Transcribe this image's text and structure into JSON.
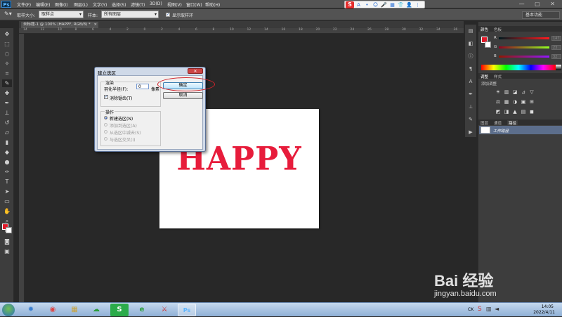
{
  "app": {
    "logo": "Ps",
    "menus": [
      "文件(F)",
      "编辑(E)",
      "图像(I)",
      "图层(L)",
      "文字(Y)",
      "选择(S)",
      "滤镜(T)",
      "3D(D)",
      "视图(V)",
      "窗口(W)",
      "帮助(H)"
    ],
    "window_controls": "—  ▢  ✕"
  },
  "ime": {
    "logo": "S",
    "icons": [
      "A",
      "•",
      "☺",
      "🎤",
      "▦",
      "👕",
      "👤",
      "⋮"
    ]
  },
  "options_bar": {
    "sample_size_label": "取样大小:",
    "sample_size_value": "取样点",
    "sample_label": "样本:",
    "sample_value": "所有图层",
    "show_ring_label": "显示取样环",
    "show_ring_checked": true,
    "workspace": "基本功能"
  },
  "document_tab": {
    "title": "未标题-1 @ 100% (HAPPY, RGB/8) *",
    "close": "×"
  },
  "ruler_h_ticks": [
    "14",
    "12",
    "10",
    "8",
    "6",
    "4",
    "2",
    "0",
    "2",
    "4",
    "6",
    "8",
    "10",
    "12",
    "14",
    "16",
    "18",
    "20",
    "22",
    "24",
    "26",
    "28",
    "30",
    "32",
    "34",
    "36"
  ],
  "canvas": {
    "text": "HAPPY",
    "text_color": "#e71c3b"
  },
  "dialog": {
    "title": "建立选区",
    "close": "✕",
    "render_group": "渲染",
    "feather_label": "羽化半径(F):",
    "feather_value": "0",
    "feather_unit": "像素",
    "anti_alias_label": "消除锯齿(T)",
    "anti_alias_checked": true,
    "operation_group": "操作",
    "operations": [
      {
        "label": "新建选区(N)",
        "selected": true,
        "enabled": true
      },
      {
        "label": "添加到选区(A)",
        "selected": false,
        "enabled": false
      },
      {
        "label": "从选区中减去(S)",
        "selected": false,
        "enabled": false
      },
      {
        "label": "与选区交叉(I)",
        "selected": false,
        "enabled": false
      }
    ],
    "ok_label": "确定",
    "cancel_label": "取消",
    "highlight_color": "#d2232a"
  },
  "color_panel": {
    "tabs": [
      "颜色",
      "色板"
    ],
    "fg_color": "#e11a2a",
    "sliders": [
      {
        "name": "R",
        "value": "147"
      },
      {
        "name": "G",
        "value": "23"
      },
      {
        "name": "B",
        "value": "32"
      }
    ]
  },
  "adjustments_panel": {
    "tabs": [
      "调整",
      "样式"
    ],
    "add_label": "添加调整",
    "row1": [
      "☀",
      "▥",
      "◪",
      "⊿",
      "▽"
    ],
    "row2": [
      "⚖",
      "▦",
      "◑",
      "▣",
      "⊞"
    ],
    "row3": [
      "◩",
      "◨",
      "▲",
      "▤",
      "◼"
    ]
  },
  "paths_panel": {
    "tabs": [
      "图层",
      "通道",
      "路径"
    ],
    "active_tab": "路径",
    "item": "工作路径"
  },
  "taskbar": {
    "apps": [
      "✹",
      "◉",
      "▦",
      "☁",
      "S",
      "e",
      "⚔",
      "Ps"
    ],
    "active_app": "Ps",
    "tray_lang": "CK",
    "time": "14:05",
    "date": "2022/4/11"
  },
  "watermark": {
    "logo": "Bai 经验",
    "url": "jingyan.baidu.com"
  }
}
